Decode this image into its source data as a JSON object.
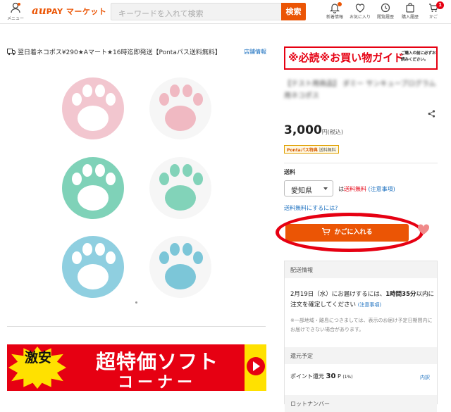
{
  "header": {
    "menu_label": "メニュー",
    "logo_au": "au",
    "logo_rest": "PAY マーケット",
    "search_placeholder": "キーワードを入れて検索",
    "search_button": "検索",
    "icons": [
      {
        "name": "bell-icon",
        "label": "新着情報"
      },
      {
        "name": "heart-icon",
        "label": "お気に入り"
      },
      {
        "name": "history-icon",
        "label": "閲覧履歴"
      },
      {
        "name": "bag-icon",
        "label": "購入履歴"
      },
      {
        "name": "cart-icon",
        "label": "かご",
        "badge": "1"
      }
    ]
  },
  "product": {
    "shipping_headline": "翌日着ネコポス¥290★Aマート★16時迄即発送【Pontaパス送料無料】",
    "store_info_link": "店舗情報",
    "guide_main": "※必読※お買い物ガイド",
    "guide_sub": "ご購入の前に必ずお読みください。",
    "title": "【テスト用商品】 ダミー サンキューブログラム用ネコポス",
    "price": "3,000",
    "price_unit": "円(税込)",
    "ponta_badge_a": "Pontaパス特典",
    "ponta_badge_b": "送料無料",
    "shipping_label": "送料",
    "prefecture": "愛知県",
    "freeship_prefix": "は",
    "freeship_red": "送料無料",
    "notes_link": "(注意事項)",
    "how_free_link": "送料無料にするには?",
    "cart_button": "かごに入れる"
  },
  "panel": {
    "delivery_header": "配送情報",
    "delivery_text_a": "2月19日（水）にお届けするには、",
    "delivery_text_b": "1時間35分",
    "delivery_text_c": "以内に注文を確定してください",
    "delivery_link": "(注意事項)",
    "delivery_note": "※一部地域・離島につきましては、表示のお届け予定日期間内にお届けできない場合があります。",
    "return_header": "還元予定",
    "point_label": "ポイント還元",
    "point_value": "30",
    "point_unit": "P",
    "point_rate": "(1%)",
    "detail_link": "内訳",
    "lot_header": "ロットナンバー"
  },
  "banner": {
    "burst_text": "激安",
    "line1": "超特価ソフト",
    "line2": "コーナー"
  },
  "colors": {
    "accent": "#eb5505",
    "alert_red": "#e60012",
    "link": "#1a6fbf"
  }
}
